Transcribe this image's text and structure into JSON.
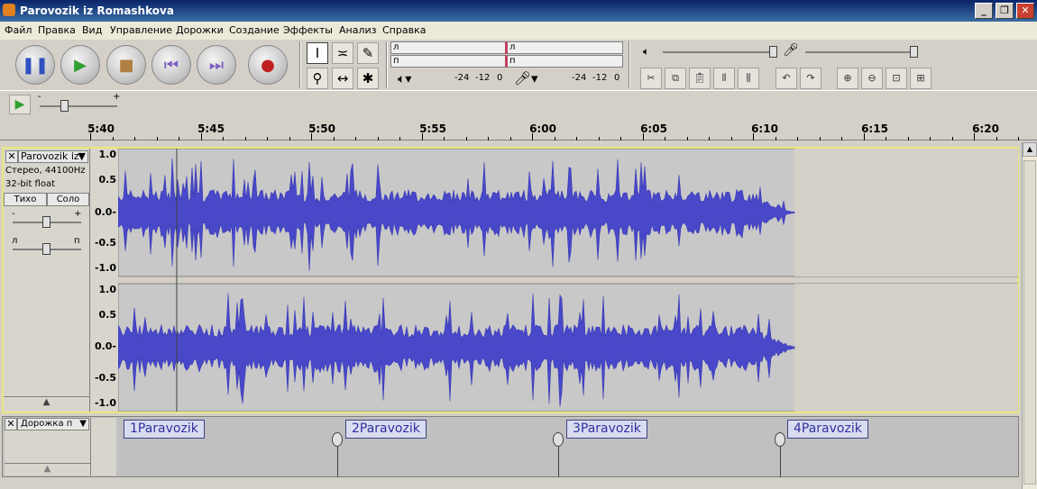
{
  "window": {
    "title": "Parovozik iz Romashkova"
  },
  "menu": [
    "Файл",
    "Правка",
    "Вид",
    "Управление",
    "Дорожки",
    "Создание",
    "Эффекты",
    "Анализ",
    "Справка"
  ],
  "meter": {
    "left": "л",
    "right": "п",
    "scale": [
      "-24",
      "-12",
      "0"
    ]
  },
  "ruler": {
    "labels": [
      "5:40",
      "5:45",
      "5:50",
      "5:55",
      "6:00",
      "6:05",
      "6:10",
      "6:15",
      "6:20"
    ]
  },
  "track": {
    "name": "Parovozik iz",
    "format": "Стерео, 44100Hz",
    "bits": "32-bit float",
    "mute": "Тихо",
    "solo": "Соло",
    "gain_minus": "-",
    "gain_plus": "+",
    "pan_left": "л",
    "pan_right": "п",
    "vscale": [
      "1.0",
      "0.5",
      "0.0-",
      "-0.5",
      "-1.0"
    ]
  },
  "labeltrack": {
    "name": "Дорожка п",
    "labels": [
      "1Paravozik",
      "2Paravozik",
      "3Paravozik",
      "4Paravozik"
    ]
  },
  "playslider": {
    "minus": "-",
    "plus": "+"
  }
}
